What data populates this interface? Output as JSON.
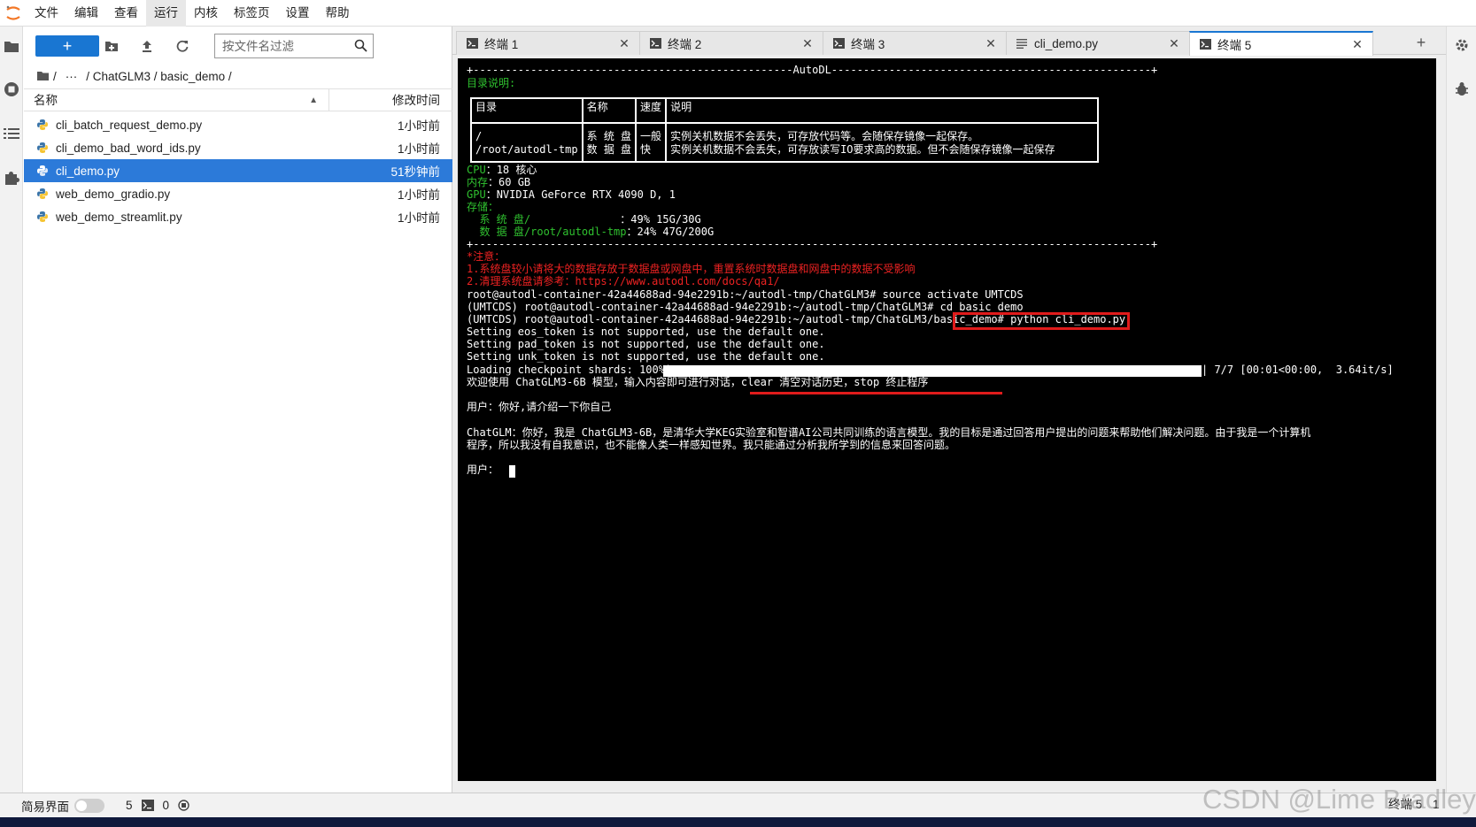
{
  "menubar": {
    "items": [
      "文件",
      "编辑",
      "查看",
      "运行",
      "内核",
      "标签页",
      "设置",
      "帮助"
    ],
    "active_index": 3
  },
  "filebrowser": {
    "new_button_label": "+",
    "filter_placeholder": "按文件名过滤",
    "breadcrumb": {
      "root_sep": "/",
      "ellipsis": "···",
      "path": "/ ChatGLM3 / basic_demo /"
    },
    "header": {
      "name": "名称",
      "modified": "修改时间"
    },
    "files": [
      {
        "name": "cli_batch_request_demo.py",
        "modified": "1小时前",
        "selected": false
      },
      {
        "name": "cli_demo_bad_word_ids.py",
        "modified": "1小时前",
        "selected": false
      },
      {
        "name": "cli_demo.py",
        "modified": "51秒钟前",
        "selected": true
      },
      {
        "name": "web_demo_gradio.py",
        "modified": "1小时前",
        "selected": false
      },
      {
        "name": "web_demo_streamlit.py",
        "modified": "1小时前",
        "selected": false
      }
    ]
  },
  "tabs": [
    {
      "label": "终端 1",
      "type": "terminal",
      "active": false
    },
    {
      "label": "终端 2",
      "type": "terminal",
      "active": false
    },
    {
      "label": "终端 3",
      "type": "terminal",
      "active": false
    },
    {
      "label": "cli_demo.py",
      "type": "file",
      "active": false
    },
    {
      "label": "终端 5",
      "type": "terminal",
      "active": true
    }
  ],
  "tab_add_label": "+",
  "terminal": {
    "banner_top": "+--------------------------------------------------AutoDL--------------------------------------------------+",
    "dir_title": "目录说明:",
    "table": {
      "header": [
        "目录",
        "名称",
        "速度",
        "说明"
      ],
      "dirs": "/\n/root/autodl-tmp",
      "names": "系 统 盘\n数 据 盘",
      "speeds": "一般\n快",
      "descs": "实例关机数据不会丢失，可存放代码等。会随保存镜像一起保存。\n实例关机数据不会丢失，可存放读写IO要求高的数据。但不会随保存镜像一起保存"
    },
    "cpu_label": "CPU",
    "cpu_value": "：18 核心",
    "mem_label": "内存",
    "mem_value": "：60 GB",
    "gpu_label": "GPU",
    "gpu_value": "：NVIDIA GeForce RTX 4090 D, 1",
    "storage_label": "存储：",
    "sys_disk_label": "  系 统 盘/              ",
    "sys_disk_value": "：49% 15G/30G",
    "data_disk_label": "  数 据 盘/root/autodl-tmp",
    "data_disk_value": "：24% 47G/200G",
    "banner_bottom": "+----------------------------------------------------------------------------------------------------------+",
    "note_title": "*注意：",
    "note_1": "1.系统盘较小请将大的数据存放于数据盘或网盘中，重置系统时数据盘和网盘中的数据不受影响",
    "note_2": "2.清理系统盘请参考：https://www.autodl.com/docs/qa1/",
    "cmd_1": "root@autodl-container-42a44688ad-94e2291b:~/autodl-tmp/ChatGLM3# source activate UMTCDS",
    "cmd_2": "(UMTCDS) root@autodl-container-42a44688ad-94e2291b:~/autodl-tmp/ChatGLM3# cd basic_demo",
    "cmd_3": "(UMTCDS) root@autodl-container-42a44688ad-94e2291b:~/autodl-tmp/ChatGLM3/basic_demo# python cli_demo.py",
    "warn_1": "Setting eos_token is not supported, use the default one.",
    "warn_2": "Setting pad_token is not supported, use the default one.",
    "warn_3": "Setting unk_token is not supported, use the default one.",
    "loading_label": "Loading checkpoint shards: 100%|",
    "loading_stats": "| 7/7 [00:01<00:00,  3.64it/s]",
    "loading_progress": 1.0,
    "welcome": "欢迎使用 ChatGLM3-6B 模型，输入内容即可进行对话，clear 清空对话历史，stop 终止程序",
    "user_1": "用户：你好,请介绍一下你自己",
    "bot_1a": "ChatGLM：你好，我是 ChatGLM3-6B，是清华大学KEG实验室和智谱AI公司共同训练的语言模型。我的目标是通过回答用户提出的问题来帮助他们解决问题。由于我是一个计算机",
    "bot_1b": "程序，所以我没有自我意识，也不能像人类一样感知世界。我只能通过分析我所学到的信息来回答问题。",
    "user_prompt": "用户："
  },
  "statusbar": {
    "simple_mode_label": "简易界面",
    "kernel_count": "5",
    "terminal_count": "0",
    "right_label": "终端 5",
    "right_num": "1"
  },
  "watermark": "CSDN @Lime Bradley",
  "colors": {
    "accent": "#1976d2",
    "selected_row": "#2c7ad9",
    "terminal_green": "#2fc12f",
    "terminal_red": "#e22222",
    "highlight_red": "#e01b1b"
  },
  "icons": {
    "activity": [
      "folder-icon",
      "stop-circle-icon",
      "list-icon",
      "puzzle-icon"
    ],
    "right": [
      "gear-icon",
      "bug-icon"
    ]
  }
}
